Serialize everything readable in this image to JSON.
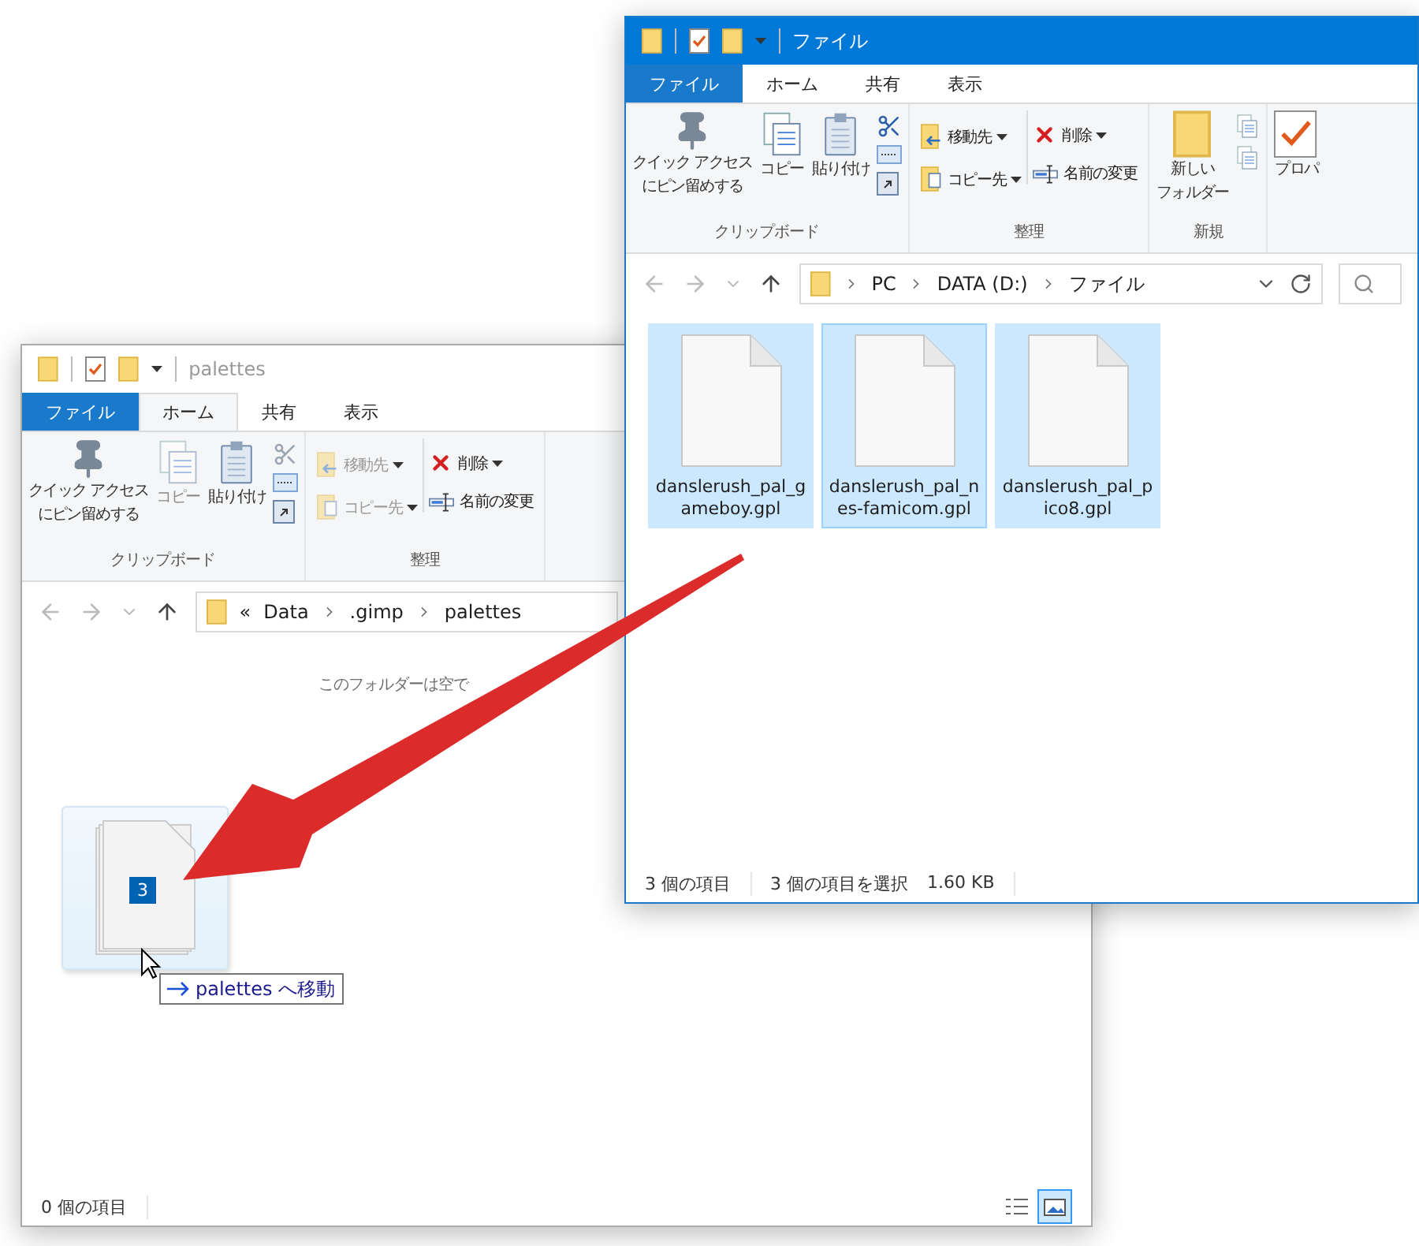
{
  "windows": [
    {
      "kind": "back",
      "active": false,
      "title": "palettes",
      "tabs": [
        {
          "label": "ファイル",
          "kind": "file",
          "selected": false
        },
        {
          "label": "ホーム",
          "kind": "tab",
          "selected": true
        },
        {
          "label": "共有",
          "kind": "tab",
          "selected": false
        },
        {
          "label": "表示",
          "kind": "tab",
          "selected": false
        }
      ],
      "ribbon": [
        {
          "kind": "clipboard",
          "label": "クリップボード",
          "pin": [
            "クイック アクセス",
            "にピン留めする"
          ],
          "copy": {
            "label": "コピー",
            "disabled": true
          },
          "paste": {
            "label": "貼り付け",
            "disabled": false
          },
          "cut": {
            "disabled": true
          }
        },
        {
          "kind": "organize",
          "label": "整理",
          "items": [
            {
              "label": "移動先",
              "dropdown": true,
              "disabled": true
            },
            {
              "label": "コピー先",
              "dropdown": true,
              "disabled": true
            },
            {
              "label": "削除",
              "dropdown": true,
              "disabled": false
            },
            {
              "label": "名前の変更",
              "dropdown": false,
              "disabled": false
            }
          ]
        }
      ],
      "address": {
        "prefix": "«",
        "segments": [
          "Data",
          ".gimp",
          "palettes"
        ]
      },
      "empty_message": "このフォルダーは空で",
      "drag": {
        "count": "3",
        "tooltip": "palettes へ移動"
      },
      "status": {
        "groups": [
          [
            "0 個の項目"
          ]
        ],
        "views": [
          {
            "kind": "details",
            "selected": false
          },
          {
            "kind": "large",
            "selected": true
          }
        ]
      }
    },
    {
      "kind": "front",
      "active": true,
      "title": "ファイル",
      "tabs": [
        {
          "label": "ファイル",
          "kind": "file",
          "selected": false
        },
        {
          "label": "ホーム",
          "kind": "tab",
          "selected": false
        },
        {
          "label": "共有",
          "kind": "tab",
          "selected": false
        },
        {
          "label": "表示",
          "kind": "tab",
          "selected": false
        }
      ],
      "ribbon": [
        {
          "kind": "clipboard",
          "label": "クリップボード",
          "pin": [
            "クイック アクセス",
            "にピン留めする"
          ],
          "copy": {
            "label": "コピー",
            "disabled": false
          },
          "paste": {
            "label": "貼り付け",
            "disabled": false
          },
          "cut": {
            "disabled": false
          }
        },
        {
          "kind": "organize",
          "label": "整理",
          "items": [
            {
              "label": "移動先",
              "dropdown": true,
              "disabled": false
            },
            {
              "label": "コピー先",
              "dropdown": true,
              "disabled": false
            },
            {
              "label": "削除",
              "dropdown": true,
              "disabled": false
            },
            {
              "label": "名前の変更",
              "dropdown": false,
              "disabled": false
            }
          ]
        },
        {
          "kind": "new",
          "label": "新規",
          "folder": [
            "新しい",
            "フォルダー"
          ]
        },
        {
          "kind": "open",
          "button": "プロパ"
        }
      ],
      "address": {
        "segments": [
          "PC",
          "DATA (D:)",
          "ファイル"
        ]
      },
      "search_field": true,
      "files": [
        {
          "lines": [
            "danslerush_pal_g",
            "ameboy.gpl"
          ],
          "selected": true,
          "focused": false
        },
        {
          "lines": [
            "danslerush_pal_n",
            "es-famicom.gpl"
          ],
          "selected": true,
          "focused": true
        },
        {
          "lines": [
            "danslerush_pal_p",
            "ico8.gpl"
          ],
          "selected": true,
          "focused": false
        }
      ],
      "status": {
        "groups": [
          [
            "3 個の項目"
          ],
          [
            "3 個の項目を選択",
            "1.60 KB"
          ]
        ]
      }
    }
  ]
}
